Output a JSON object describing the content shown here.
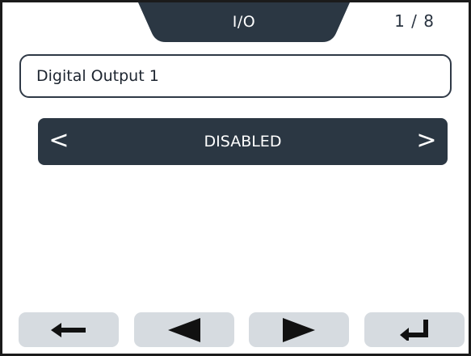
{
  "header": {
    "title": "I/O",
    "page_counter": "1 / 8"
  },
  "name_field": {
    "value": "Digital Output 1"
  },
  "selector": {
    "left_arrow": "<",
    "value": "DISABLED",
    "right_arrow": ">"
  },
  "buttons": [
    {
      "name": "back",
      "icon": "arrow-left-icon"
    },
    {
      "name": "previous",
      "icon": "triangle-left-icon"
    },
    {
      "name": "next",
      "icon": "triangle-right-icon"
    },
    {
      "name": "enter",
      "icon": "return-icon"
    }
  ],
  "colors": {
    "dark": "#2b3743",
    "button_bg": "#d6dbe0",
    "text_light": "#ffffff"
  }
}
